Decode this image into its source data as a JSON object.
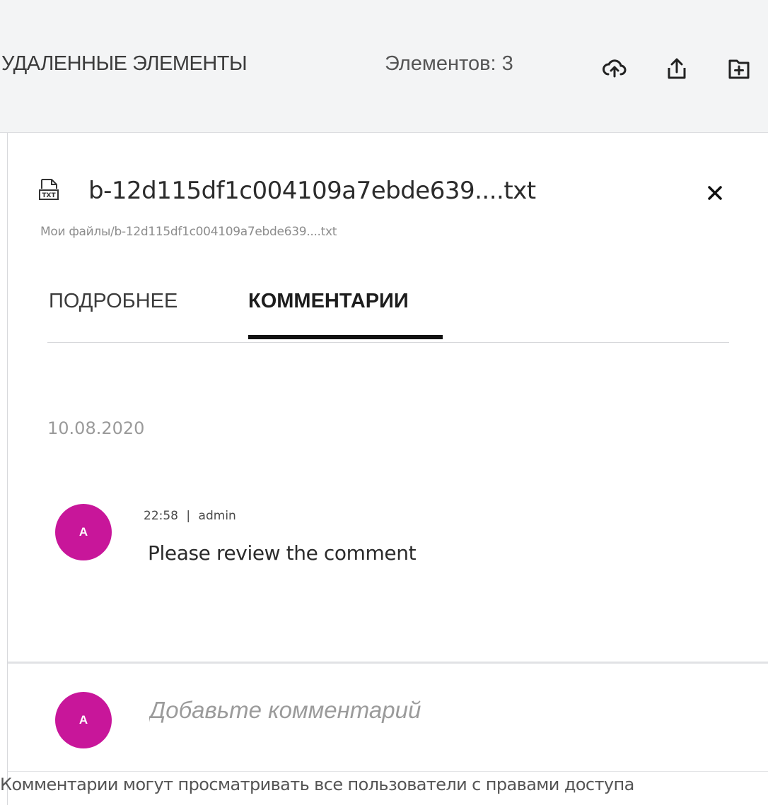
{
  "toolbar": {
    "title": "УДАЛЕННЫЕ ЭЛЕМЕНТЫ",
    "count_text": "Элементов: 3",
    "icons": [
      "cloud-upload-icon",
      "share-upload-icon",
      "new-folder-icon"
    ]
  },
  "file": {
    "icon": "txt-file-icon",
    "name": "b-12d115df1c004109a7ebde639....txt",
    "path": "Мои файлы/b-12d115df1c004109a7ebde639....txt",
    "close_icon": "close-icon"
  },
  "tabs": [
    {
      "label": "ПОДРОБНЕЕ",
      "active": false
    },
    {
      "label": "КОММЕНТАРИИ",
      "active": true
    }
  ],
  "comments": {
    "date": "10.08.2020",
    "items": [
      {
        "avatar_initial": "A",
        "time": "22:58",
        "separator": "|",
        "author": "admin",
        "text": "Please review the comment"
      }
    ]
  },
  "composer": {
    "avatar_initial": "A",
    "placeholder": "Добавьте комментарий"
  },
  "footer": {
    "note": "Комментарии могут просматривать все пользователи с правами доступа"
  },
  "colors": {
    "avatar": "#c8169a",
    "toolbar_bg": "#f3f4f5",
    "tab_active_underline": "#111111"
  }
}
